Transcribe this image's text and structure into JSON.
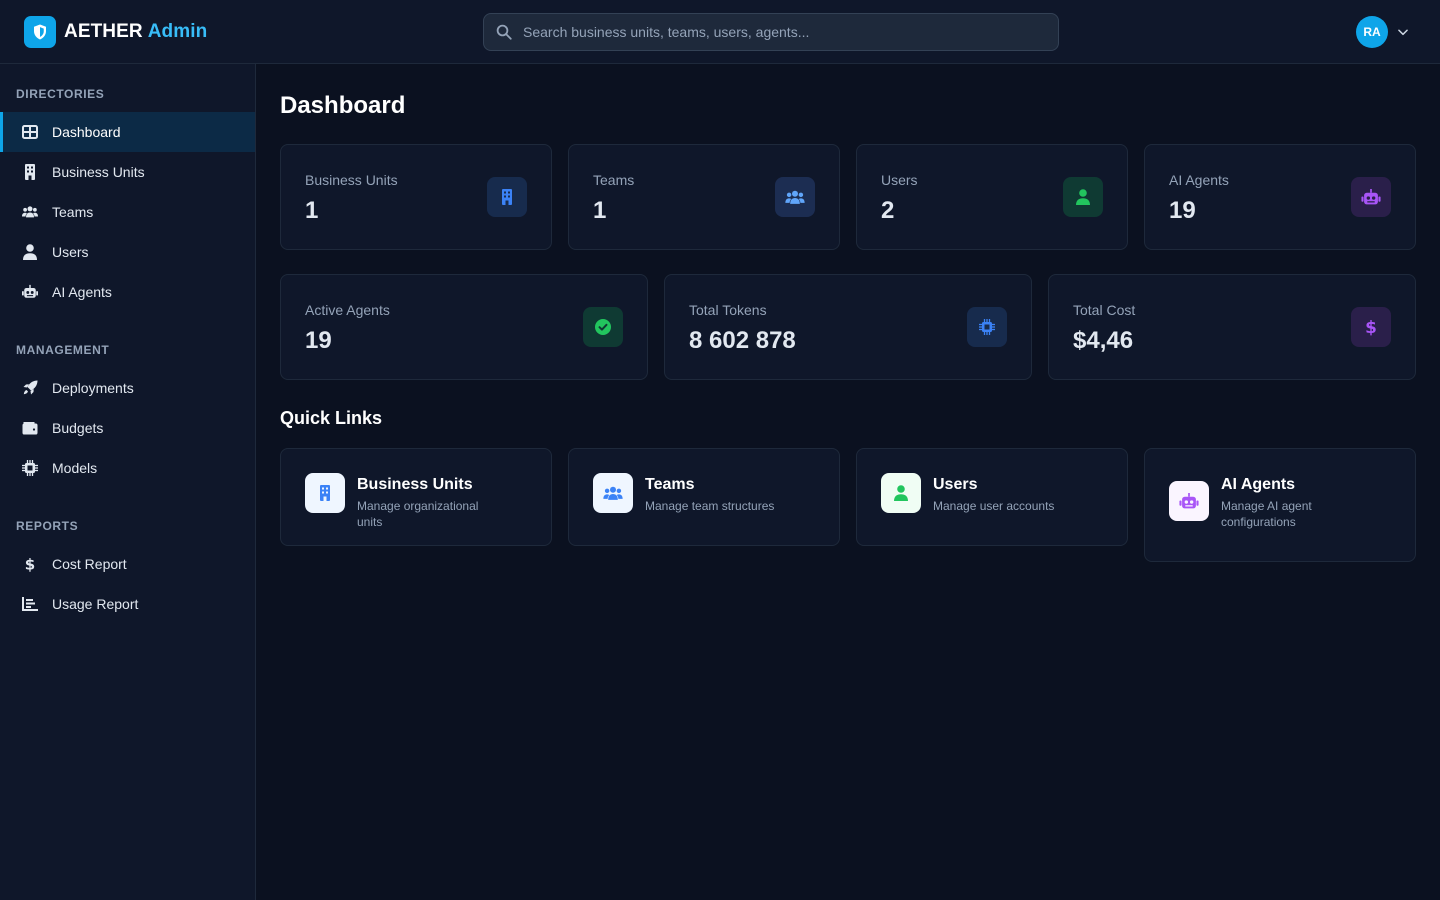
{
  "brand": {
    "name": "AETHER",
    "suffix": "Admin"
  },
  "search": {
    "placeholder": "Search business units, teams, users, agents..."
  },
  "user": {
    "initials": "RA"
  },
  "sidebar": {
    "sections": [
      {
        "title": "DIRECTORIES",
        "items": [
          {
            "label": "Dashboard",
            "icon": "grid-icon",
            "active": true
          },
          {
            "label": "Business Units",
            "icon": "building-icon"
          },
          {
            "label": "Teams",
            "icon": "people-icon"
          },
          {
            "label": "Users",
            "icon": "user-icon"
          },
          {
            "label": "AI Agents",
            "icon": "robot-icon"
          }
        ]
      },
      {
        "title": "MANAGEMENT",
        "items": [
          {
            "label": "Deployments",
            "icon": "rocket-icon"
          },
          {
            "label": "Budgets",
            "icon": "wallet-icon"
          },
          {
            "label": "Models",
            "icon": "chip-icon"
          }
        ]
      },
      {
        "title": "REPORTS",
        "items": [
          {
            "label": "Cost Report",
            "icon": "dollar-icon"
          },
          {
            "label": "Usage Report",
            "icon": "bar-chart-icon"
          }
        ]
      }
    ]
  },
  "main": {
    "title": "Dashboard",
    "stats_row1": [
      {
        "label": "Business Units",
        "value": "1",
        "icon": "building-icon",
        "icon_color": "#3b82f6",
        "icon_bg": "#172b4d"
      },
      {
        "label": "Teams",
        "value": "1",
        "icon": "people-icon",
        "icon_color": "#60a5fa",
        "icon_bg": "#1c2d52"
      },
      {
        "label": "Users",
        "value": "2",
        "icon": "user-icon",
        "icon_color": "#22c55e",
        "icon_bg": "#0f3a33"
      },
      {
        "label": "AI Agents",
        "value": "19",
        "icon": "robot-icon",
        "icon_color": "#a855f7",
        "icon_bg": "#2a1f4a"
      }
    ],
    "stats_row2": [
      {
        "label": "Active Agents",
        "value": "19",
        "icon": "check-circle-icon",
        "icon_color": "#22c55e",
        "icon_bg": "#0f3a33"
      },
      {
        "label": "Total Tokens",
        "value": "8 602 878",
        "icon": "chip-icon",
        "icon_color": "#3b82f6",
        "icon_bg": "#172b4d"
      },
      {
        "label": "Total Cost",
        "value": "$4,46",
        "icon": "dollar-icon",
        "icon_color": "#a855f7",
        "icon_bg": "#2a1f4a"
      }
    ],
    "quick_links_title": "Quick Links",
    "quick_links": [
      {
        "title": "Business Units",
        "description": "Manage organizational units",
        "icon": "building-icon",
        "icon_color": "#3b82f6",
        "icon_bg": "#eff6ff"
      },
      {
        "title": "Teams",
        "description": "Manage team structures",
        "icon": "people-icon",
        "icon_color": "#3b82f6",
        "icon_bg": "#eff6ff"
      },
      {
        "title": "Users",
        "description": "Manage user accounts",
        "icon": "user-icon",
        "icon_color": "#22c55e",
        "icon_bg": "#f0fdf4"
      },
      {
        "title": "AI Agents",
        "description": "Manage AI agent configurations",
        "icon": "robot-icon",
        "icon_color": "#a855f7",
        "icon_bg": "#faf5ff"
      }
    ]
  }
}
